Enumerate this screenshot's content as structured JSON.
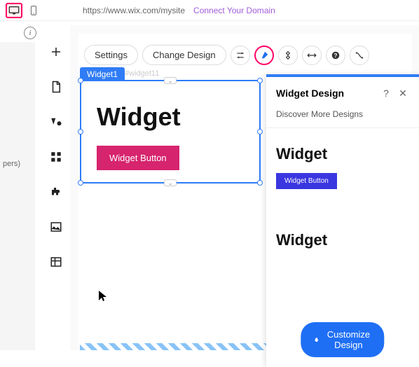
{
  "topbar": {
    "url": "https://www.wix.com/mysite",
    "connect": "Connect Your Domain"
  },
  "sidebar": {
    "layers_label": "pers)"
  },
  "toolbar": {
    "settings": "Settings",
    "change_design": "Change Design"
  },
  "widget": {
    "tag": "Widget1",
    "id": "#widget11",
    "title": "Widget",
    "button": "Widget Button"
  },
  "panel": {
    "title": "Widget Design",
    "help": "?",
    "close": "✕",
    "subtitle": "Discover More Designs",
    "designs": [
      {
        "title": "Widget",
        "button": "Widget Button"
      },
      {
        "title": "Widget"
      }
    ],
    "customize": "Customize Design"
  }
}
